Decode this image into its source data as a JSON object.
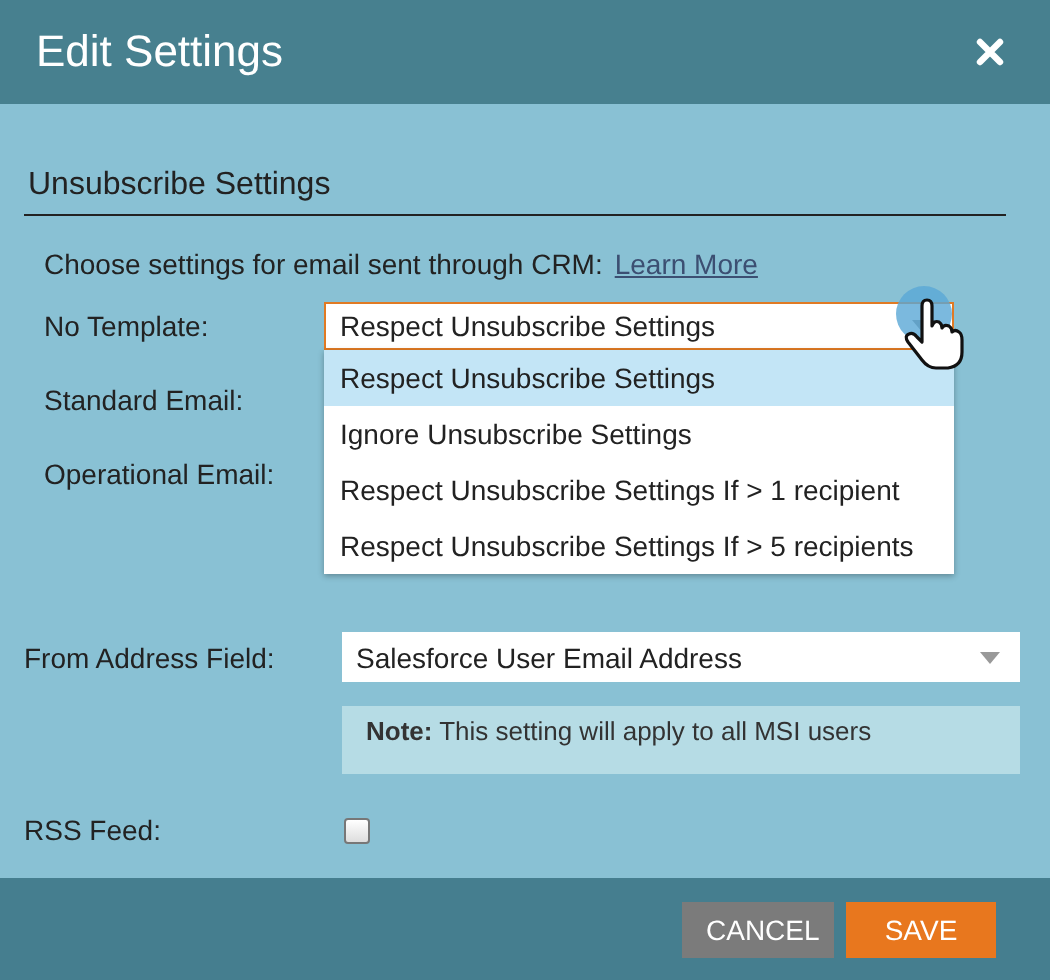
{
  "window": {
    "title": "Edit Settings"
  },
  "section": {
    "title": "Unsubscribe Settings",
    "intro": "Choose settings for email sent through CRM:",
    "link": "Learn More"
  },
  "crm_rows": [
    {
      "label": "No Template:",
      "value": "Respect Unsubscribe Settings",
      "expanded": true,
      "options": [
        {
          "label": "Respect Unsubscribe Settings",
          "selected": true
        },
        {
          "label": "Ignore Unsubscribe Settings",
          "selected": false
        },
        {
          "label": "Respect Unsubscribe Settings If > 1 recipient",
          "selected": false
        },
        {
          "label": "Respect Unsubscribe Settings If > 5 recipients",
          "selected": false
        }
      ]
    },
    {
      "label": "Standard Email:"
    },
    {
      "label": "Operational Email:"
    }
  ],
  "from_address": {
    "label": "From Address Field:",
    "value": "Salesforce User Email Address",
    "note": "**Note:** This setting will apply to all MSI users"
  },
  "rss_feed": {
    "label": "RSS Feed:",
    "checked": false
  },
  "buttons": [
    {
      "label": "CANCEL",
      "kind": "secondary"
    },
    {
      "label": "SAVE",
      "kind": "primary"
    }
  ]
}
